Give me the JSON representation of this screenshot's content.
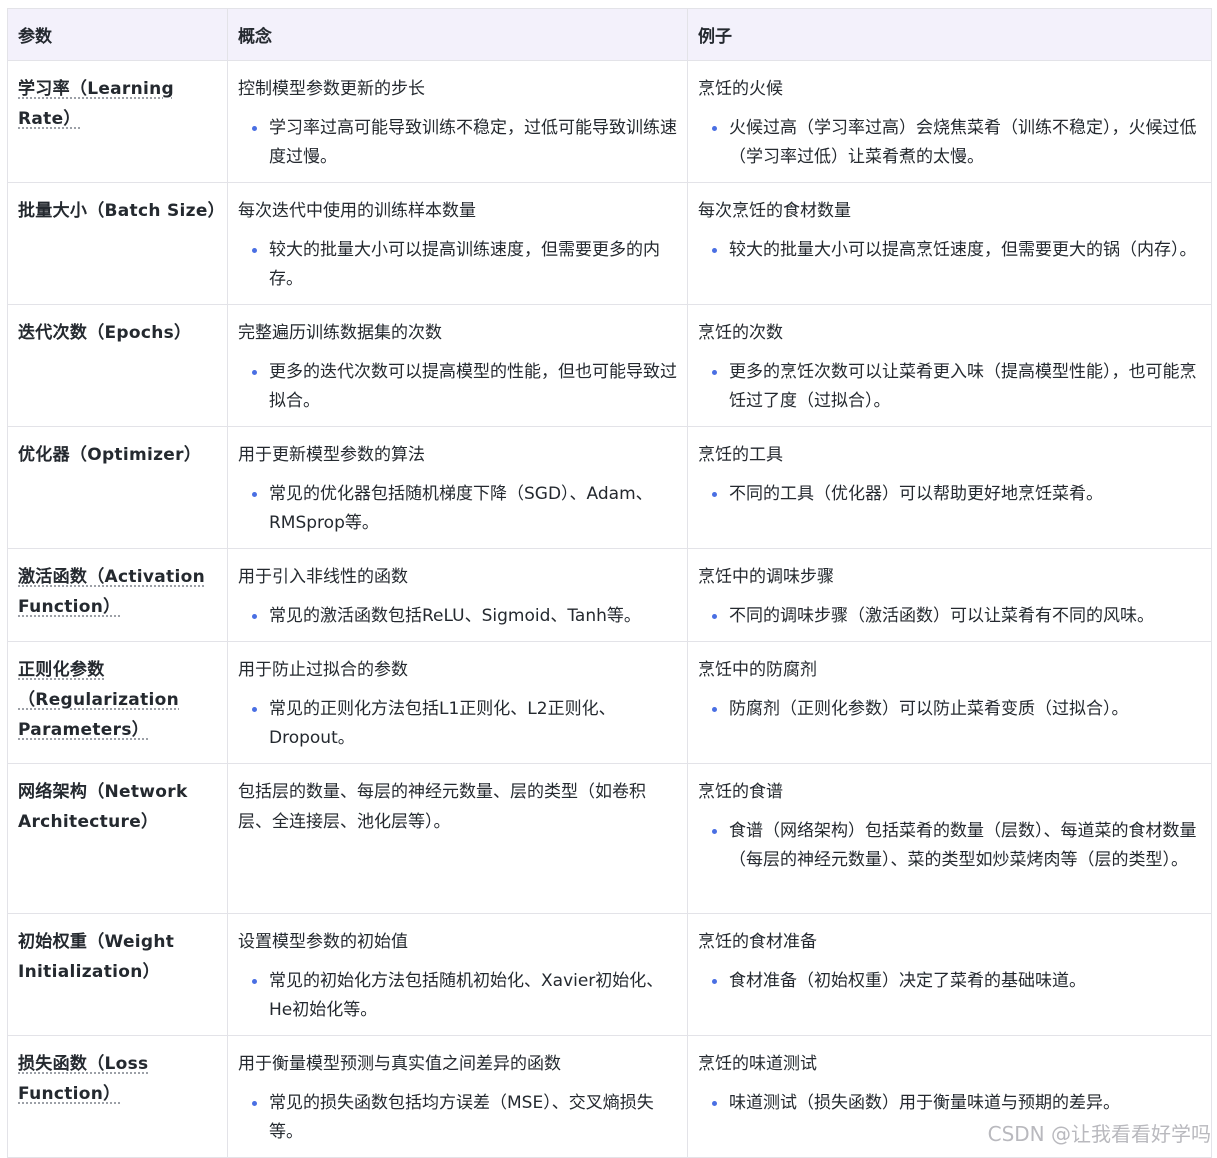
{
  "table": {
    "headers": [
      "参数",
      "概念",
      "例子"
    ],
    "rows": [
      {
        "param": "学习率（Learning Rate）",
        "concept": "控制模型参数更新的步长",
        "concept_note": "学习率过高可能导致训练不稳定，过低可能导致训练速度过慢。",
        "example": "烹饪的火候",
        "example_note": "火候过高（学习率过高）会烧焦菜肴（训练不稳定），火候过低（学习率过低）让菜肴煮的太慢。"
      },
      {
        "param": "批量大小（Batch Size）",
        "concept": "每次迭代中使用的训练样本数量",
        "concept_note": "较大的批量大小可以提高训练速度，但需要更多的内存。",
        "example": "每次烹饪的食材数量",
        "example_note": "较大的批量大小可以提高烹饪速度，但需要更大的锅（内存）。"
      },
      {
        "param": "迭代次数（Epochs）",
        "concept": "完整遍历训练数据集的次数",
        "concept_note": "更多的迭代次数可以提高模型的性能，但也可能导致过拟合。",
        "example": "烹饪的次数",
        "example_note": "更多的烹饪次数可以让菜肴更入味（提高模型性能），也可能烹饪过了度（过拟合）。"
      },
      {
        "param": "优化器（Optimizer）",
        "concept": "用于更新模型参数的算法",
        "concept_note": "常见的优化器包括随机梯度下降（SGD）、Adam、RMSprop等。",
        "example": "烹饪的工具",
        "example_note": "不同的工具（优化器）可以帮助更好地烹饪菜肴。"
      },
      {
        "param": "激活函数（Activation Function）",
        "concept": "用于引入非线性的函数",
        "concept_note": "常见的激活函数包括ReLU、Sigmoid、Tanh等。",
        "example": "烹饪中的调味步骤",
        "example_note": "不同的调味步骤（激活函数）可以让菜肴有不同的风味。"
      },
      {
        "param": "正则化参数（Regularization Parameters）",
        "concept": "用于防止过拟合的参数",
        "concept_note": "常见的正则化方法包括L1正则化、L2正则化、Dropout。",
        "example": "烹饪中的防腐剂",
        "example_note": "防腐剂（正则化参数）可以防止菜肴变质（过拟合）。"
      },
      {
        "param": "网络架构（Network Architecture）",
        "concept": "包括层的数量、每层的神经元数量、层的类型（如卷积层、全连接层、池化层等）。",
        "concept_note": "",
        "example": "烹饪的食谱",
        "example_note": "食谱（网络架构）包括菜肴的数量（层数）、每道菜的食材数量（每层的神经元数量）、菜的类型如炒菜烤肉等（层的类型）。"
      },
      {
        "param": "初始权重（Weight Initialization）",
        "concept": "设置模型参数的初始值",
        "concept_note": "常见的初始化方法包括随机初始化、Xavier初始化、He初始化等。",
        "example": "烹饪的食材准备",
        "example_note": "食材准备（初始权重）决定了菜肴的基础味道。"
      },
      {
        "param": "损失函数（Loss Function）",
        "concept": "用于衡量模型预测与真实值之间差异的函数",
        "concept_note": "常见的损失函数包括均方误差（MSE）、交叉熵损失等。",
        "example": "烹饪的味道测试",
        "example_note": "味道测试（损失函数）用于衡量味道与预期的差异。"
      }
    ]
  },
  "watermark": "CSDN @让我看看好学吗",
  "colors": {
    "header_bg": "#f3f1fb",
    "bullet": "#4a6fe3",
    "border": "#e3e3e8"
  }
}
